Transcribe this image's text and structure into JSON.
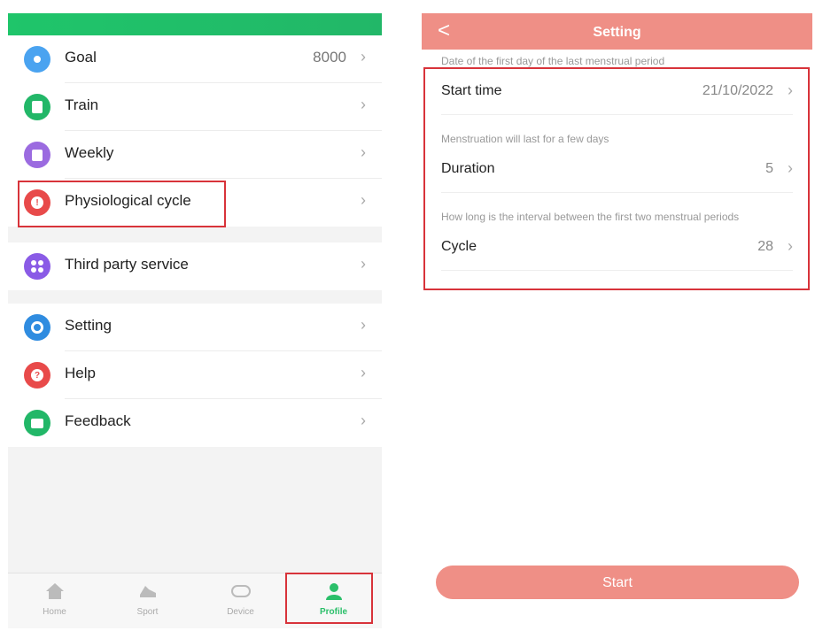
{
  "left": {
    "menu_group_1": [
      {
        "label": "Goal",
        "value": "8000",
        "icon": "target-icon",
        "color": "#4aa3f0"
      },
      {
        "label": "Train",
        "value": "",
        "icon": "train-doc-icon",
        "color": "#22b768"
      },
      {
        "label": "Weekly",
        "value": "",
        "icon": "weekly-report-icon",
        "color": "#9b6be0"
      },
      {
        "label": "Physiological cycle",
        "value": "",
        "icon": "cycle-icon",
        "color": "#e84a4a"
      }
    ],
    "menu_group_2": [
      {
        "label": "Third party service",
        "value": "",
        "icon": "third-party-icon",
        "color": "#8a5be6"
      }
    ],
    "menu_group_3": [
      {
        "label": "Setting",
        "value": "",
        "icon": "gear-icon",
        "color": "#2f8ce0"
      },
      {
        "label": "Help",
        "value": "",
        "icon": "help-icon",
        "color": "#e84a4a"
      },
      {
        "label": "Feedback",
        "value": "",
        "icon": "feedback-icon",
        "color": "#22b768"
      }
    ],
    "tabs": [
      {
        "label": "Home",
        "icon": "home-icon"
      },
      {
        "label": "Sport",
        "icon": "shoe-icon"
      },
      {
        "label": "Device",
        "icon": "watch-icon"
      },
      {
        "label": "Profile",
        "icon": "person-icon"
      }
    ],
    "active_tab": "Profile",
    "accent_color": "#22b768",
    "highlight_color": "#d8333a"
  },
  "right": {
    "back_glyph": "<",
    "title": "Setting",
    "hint_1": "Date of the first day of the last menstrual period",
    "start_time_label": "Start time",
    "start_time_value": "21/10/2022",
    "hint_2": "Menstruation will last for a few days",
    "duration_label": "Duration",
    "duration_value": "5",
    "hint_3": "How long is the interval between the first two menstrual periods",
    "cycle_label": "Cycle",
    "cycle_value": "28",
    "start_button": "Start",
    "accent_color": "#ef8f86"
  }
}
